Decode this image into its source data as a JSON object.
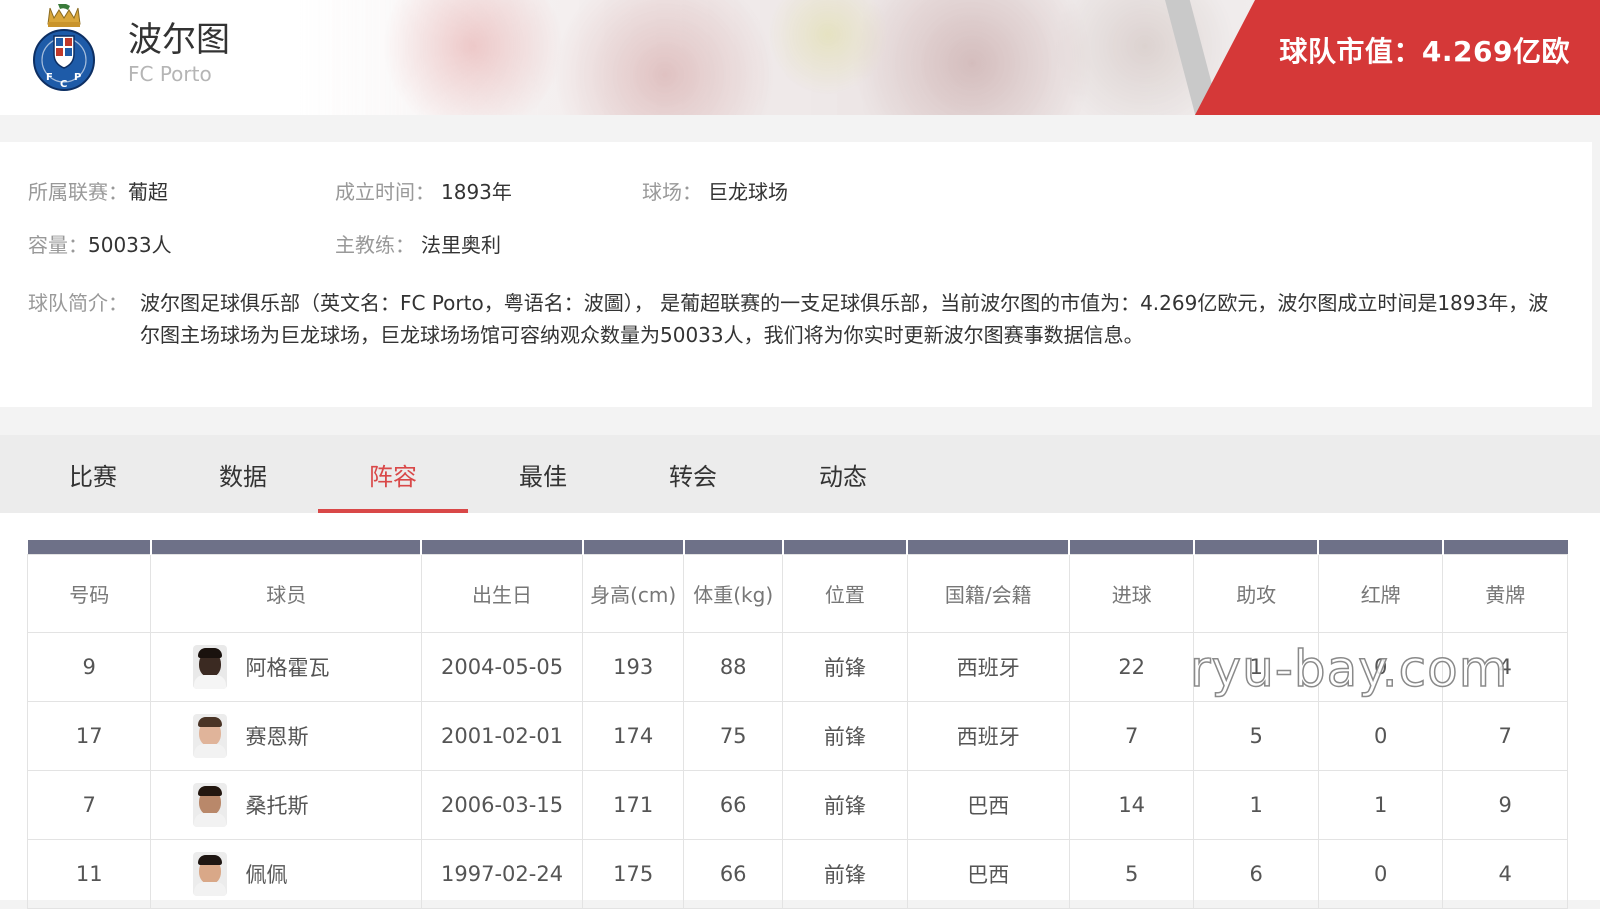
{
  "header": {
    "club_name": "波尔图",
    "club_name_en": "FC Porto",
    "market_value": "球队市值：4.269亿欧"
  },
  "colors": {
    "brand_red": "#d53838",
    "active_tab": "#d94848",
    "table_header_bar": "#6e7188"
  },
  "info": {
    "league_label": "所属联赛：",
    "league_value": "葡超",
    "founded_label": "成立时间：",
    "founded_value": "1893年",
    "stadium_label": "球场：",
    "stadium_value": "巨龙球场",
    "capacity_label": "容量：",
    "capacity_value": "50033人",
    "coach_label": "主教练：",
    "coach_value": "法里奥利",
    "intro_label": "球队简介：",
    "intro_value": "波尔图足球俱乐部（英文名：FC Porto，粤语名：波圖）， 是葡超联赛的一支足球俱乐部，当前波尔图的市值为：4.269亿欧元，波尔图成立时间是1893年，波尔图主场球场为巨龙球场，巨龙球场场馆可容纳观众数量为50033人，我们将为你实时更新波尔图赛事数据信息。"
  },
  "tabs": [
    {
      "label": "比赛"
    },
    {
      "label": "数据"
    },
    {
      "label": "阵容"
    },
    {
      "label": "最佳"
    },
    {
      "label": "转会"
    },
    {
      "label": "动态"
    }
  ],
  "table": {
    "headers": [
      "号码",
      "球员",
      "出生日",
      "身高(cm)",
      "体重(kg)",
      "位置",
      "国籍/会籍",
      "进球",
      "助攻",
      "红牌",
      "黄牌"
    ],
    "rows": [
      {
        "number": "9",
        "name": "阿格霍瓦",
        "birth": "2004-05-05",
        "height": "193",
        "weight": "88",
        "position": "前锋",
        "nationality": "西班牙",
        "goals": "22",
        "assists": "1",
        "red": "0",
        "yellow": "4"
      },
      {
        "number": "17",
        "name": "赛恩斯",
        "birth": "2001-02-01",
        "height": "174",
        "weight": "75",
        "position": "前锋",
        "nationality": "西班牙",
        "goals": "7",
        "assists": "5",
        "red": "0",
        "yellow": "7"
      },
      {
        "number": "7",
        "name": "桑托斯",
        "birth": "2006-03-15",
        "height": "171",
        "weight": "66",
        "position": "前锋",
        "nationality": "巴西",
        "goals": "14",
        "assists": "1",
        "red": "1",
        "yellow": "9"
      },
      {
        "number": "11",
        "name": "佩佩",
        "birth": "1997-02-24",
        "height": "175",
        "weight": "66",
        "position": "前锋",
        "nationality": "巴西",
        "goals": "5",
        "assists": "6",
        "red": "0",
        "yellow": "4"
      }
    ]
  },
  "watermark": "ryu-bay.com"
}
